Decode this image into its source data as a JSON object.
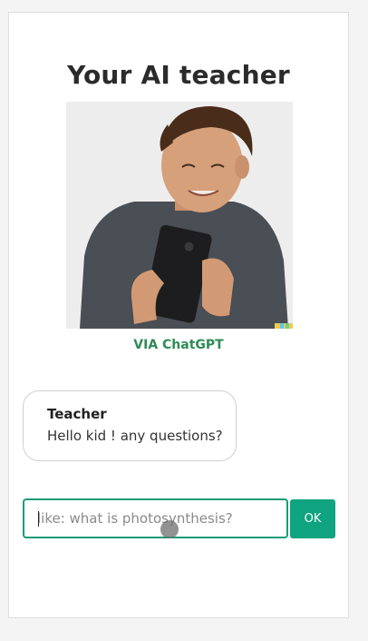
{
  "header": {
    "title": "Your AI teacher"
  },
  "image": {
    "alt": "Boy smiling at a phone",
    "credit": "VIA ChatGPT"
  },
  "chat": {
    "sender": "Teacher",
    "message": "Hello kid ! any questions?"
  },
  "composer": {
    "placeholder": "like: what is photosynthesis?",
    "value": "",
    "submit_label": "OK"
  },
  "colors": {
    "accent": "#10a37f",
    "credit": "#2e8b57",
    "title": "#2b2b2b"
  }
}
